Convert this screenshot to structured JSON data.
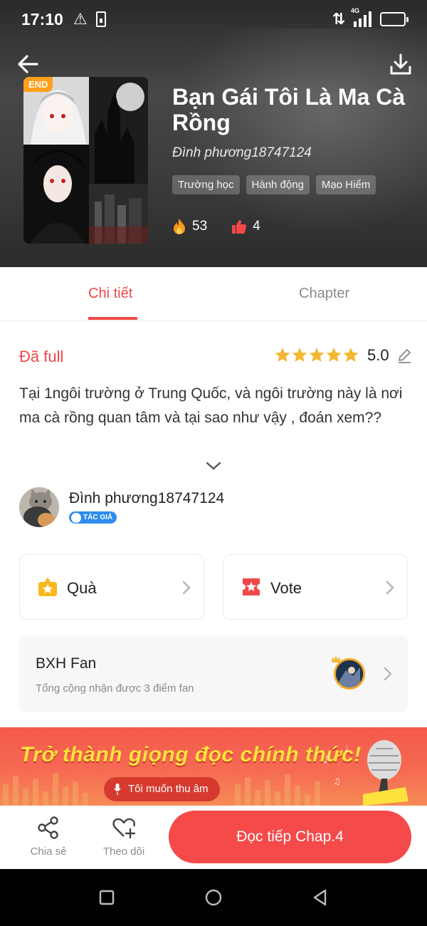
{
  "status_bar": {
    "time": "17:10",
    "network": "4G"
  },
  "book": {
    "end_badge": "END",
    "title": "Bạn Gái Tôi Là Ma Cà Rồng",
    "author": "Đình phương18747124",
    "tags": [
      "Trường học",
      "Hành động",
      "Mạo Hiểm"
    ],
    "fire_count": "53",
    "like_count": "4"
  },
  "tabs": {
    "detail": "Chi tiết",
    "chapter": "Chapter"
  },
  "detail": {
    "status": "Đã full",
    "rating": "5.0",
    "stars": 5,
    "description": "Tại 1ngôi trường ở Trung Quốc, và ngôi trường này là nơi ma cà rồng quan tâm và tại sao như vậy , đoán xem??"
  },
  "author_section": {
    "name": "Đình phương18747124",
    "badge": "TÁC GIẢ"
  },
  "cards": {
    "gift": "Quà",
    "vote": "Vote"
  },
  "fan_ranking": {
    "title": "BXH Fan",
    "subtitle": "Tổng cộng nhận được 3 điểm fan"
  },
  "banner": {
    "headline": "Trở thành giọng đọc chính thức!",
    "button": "Tôi muốn thu âm"
  },
  "bottom_bar": {
    "share": "Chia sẻ",
    "follow": "Theo dõi",
    "read": "Đọc tiếp Chap.4"
  },
  "colors": {
    "accent": "#f04848",
    "star": "#f5b731",
    "header_bg": "#3a3a3a"
  },
  "icons": [
    "back-arrow-icon",
    "download-icon",
    "fire-icon",
    "thumbs-up-icon",
    "star-icon",
    "edit-icon",
    "chevron-down-icon",
    "gift-icon",
    "ticket-icon",
    "chevron-right-icon",
    "share-icon",
    "heart-plus-icon",
    "microphone-icon"
  ]
}
